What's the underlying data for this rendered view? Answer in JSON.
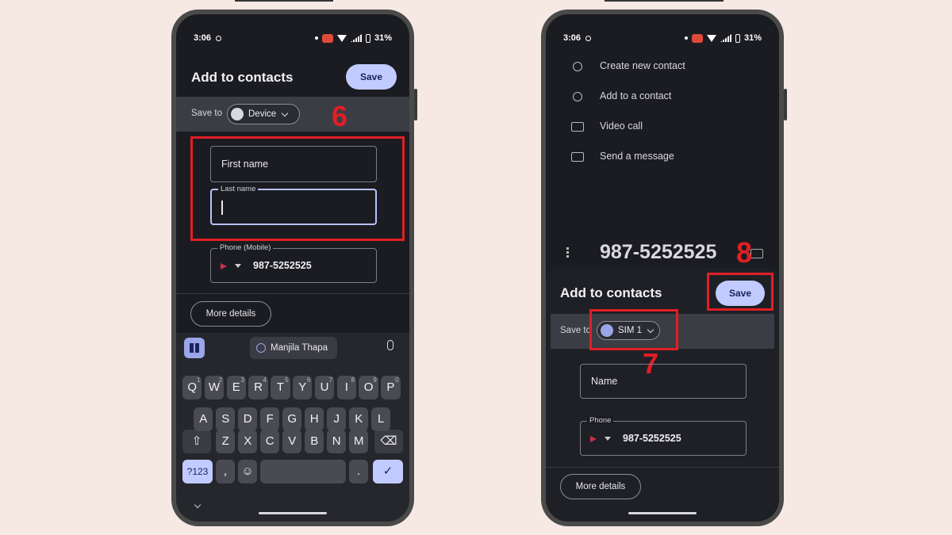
{
  "status": {
    "time": "3:06",
    "battery": "31%"
  },
  "left": {
    "title": "Add to contacts",
    "save": "Save",
    "save_to_label": "Save to",
    "account": "Device",
    "first_name": "First name",
    "last_name_label": "Last name",
    "phone_label": "Phone (Mobile)",
    "phone_value": "987-5252525",
    "more_details": "More details",
    "step": "6",
    "suggestion": "Manjila Thapa",
    "keys": {
      "row1": [
        "Q",
        "W",
        "E",
        "R",
        "T",
        "Y",
        "U",
        "I",
        "O",
        "P"
      ],
      "row1_hints": [
        "1",
        "2",
        "3",
        "4",
        "5",
        "6",
        "7",
        "8",
        "9",
        "0"
      ],
      "row2": [
        "A",
        "S",
        "D",
        "F",
        "G",
        "H",
        "J",
        "K",
        "L"
      ],
      "row3": [
        "Z",
        "X",
        "C",
        "V",
        "B",
        "N",
        "M"
      ],
      "symbols": "?123",
      "comma": ",",
      "period": "."
    }
  },
  "right": {
    "menu": [
      "Create new contact",
      "Add to a contact",
      "Video call",
      "Send a message"
    ],
    "dialed_number": "987-5252525",
    "step_save": "8",
    "title": "Add to contacts",
    "save": "Save",
    "save_to_label": "Save to",
    "account": "SIM 1",
    "step_sim": "7",
    "name_placeholder": "Name",
    "phone_label": "Phone",
    "phone_value": "987-5252525",
    "more_details": "More details"
  },
  "colors": {
    "highlight": "#e11f24",
    "accent": "#c2cbff",
    "screen_bg": "#1b1c21",
    "page_bg": "#f6e9e4"
  }
}
